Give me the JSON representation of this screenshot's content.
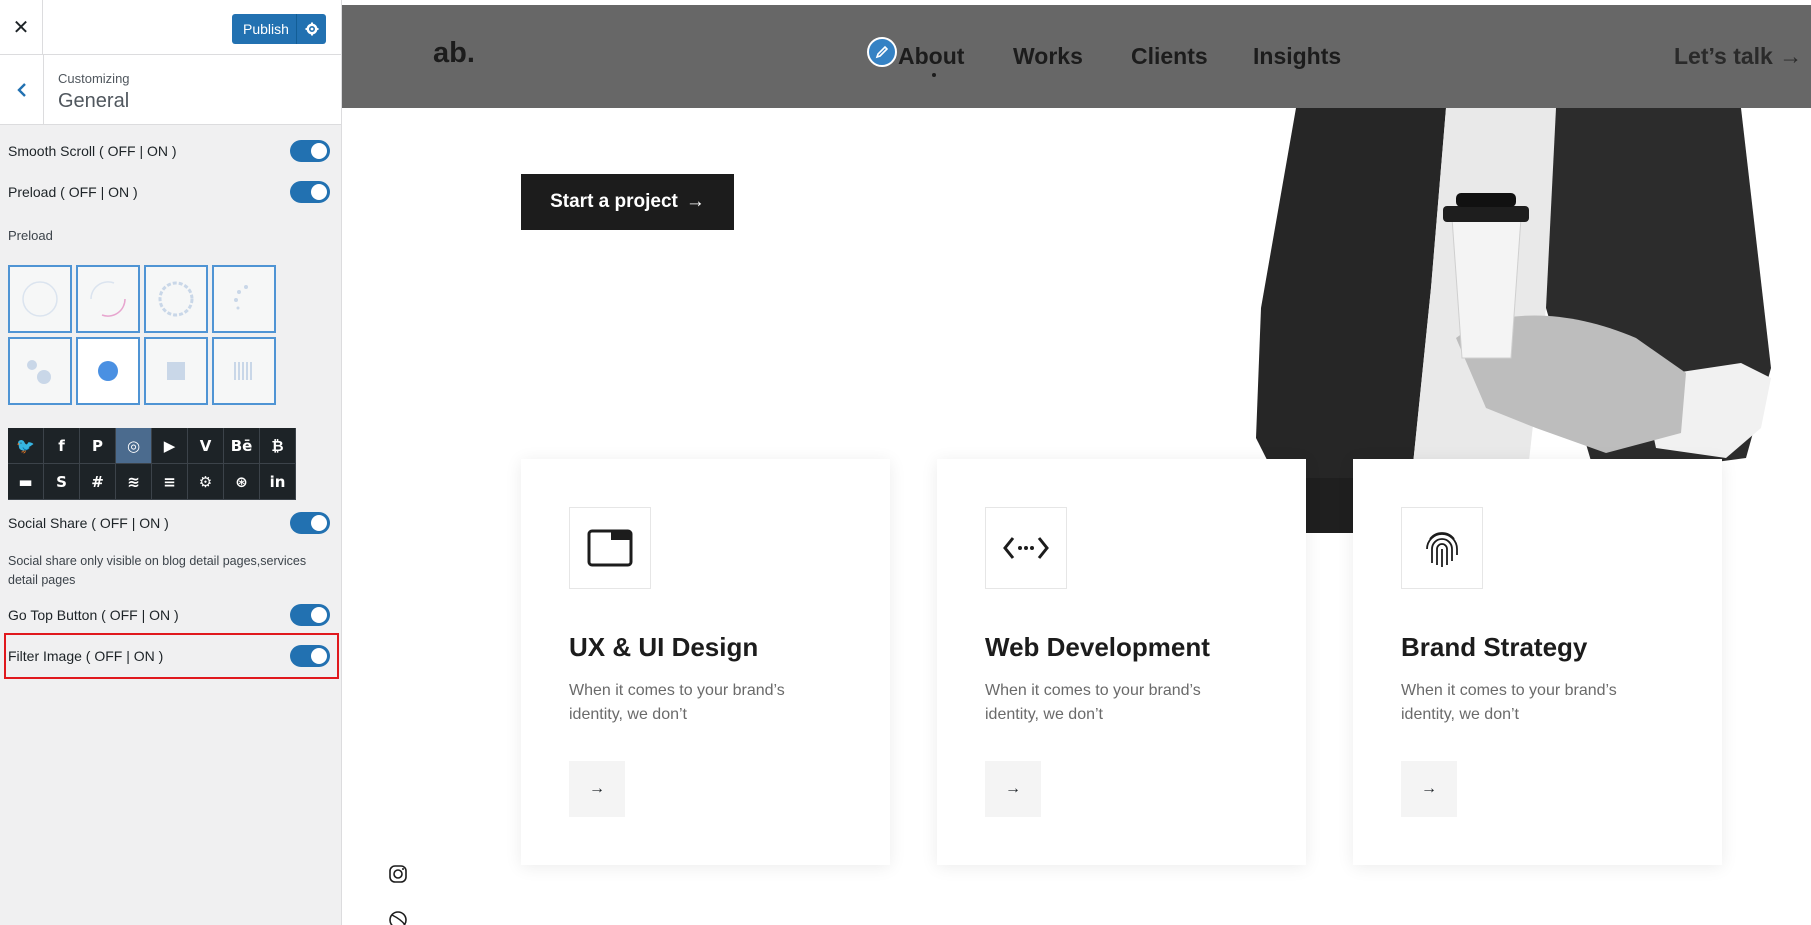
{
  "customizer": {
    "close_symbol": "✕",
    "publish_label": "Publish",
    "crumb": "Customizing",
    "section_title": "General",
    "options": [
      {
        "label": "Smooth Scroll ( OFF | ON )"
      },
      {
        "label": "Preload ( OFF | ON )"
      },
      {
        "label": "Social Share ( OFF | ON )"
      },
      {
        "label": "Go Top Button ( OFF | ON )"
      },
      {
        "label": "Filter Image ( OFF | ON )"
      }
    ],
    "preload_label": "Preload",
    "social_note": "Social share only visible on blog detail pages,services detail pages",
    "social_icons": [
      "twitter-icon",
      "facebook-icon",
      "pinterest-icon",
      "instagram-icon",
      "youtube-icon",
      "vimeo-icon",
      "behance-icon",
      "bitcoin-icon",
      "delicious-icon",
      "skype-icon",
      "slack-icon",
      "spotify-icon",
      "stackoverflow-icon",
      "steam-icon",
      "dribbble-icon",
      "linkedin-icon"
    ],
    "social_glyphs": [
      "🐦",
      "f",
      "P",
      "◎",
      "▶",
      "V",
      "Bē",
      "₿",
      "▬",
      "S",
      "#",
      "≋",
      "≡",
      "⚙",
      "⊛",
      "in"
    ]
  },
  "site": {
    "logo": "ab.",
    "nav": [
      "About",
      "Works",
      "Clients",
      "Insights"
    ],
    "lets_talk": "Let’s talk",
    "cta": "Start a project",
    "services": [
      {
        "title": "UX & UI Design",
        "text": "When it comes to your brand’s identity, we don’t",
        "icon": "browser-window-icon"
      },
      {
        "title": "Web Development",
        "text": "When it comes to your brand’s identity, we don’t",
        "icon": "code-icon"
      },
      {
        "title": "Brand Strategy",
        "text": "When it comes to your brand’s identity, we don’t",
        "icon": "fingerprint-icon"
      }
    ]
  },
  "colors": {
    "accent": "#2271b1",
    "highlight_border": "#e0181d",
    "nav_bg": "#676767"
  }
}
